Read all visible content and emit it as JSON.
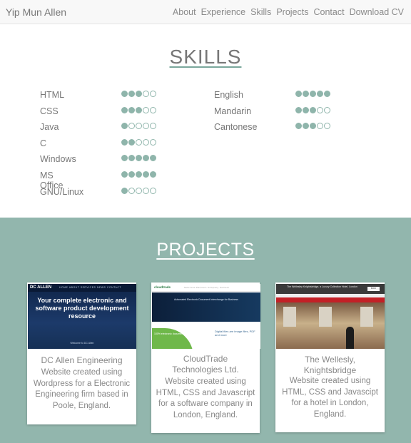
{
  "nav": {
    "brand": "Yip Mun Allen",
    "links": [
      "About",
      "Experience",
      "Skills",
      "Projects",
      "Contact",
      "Download CV"
    ]
  },
  "skills": {
    "title": "SKILLS",
    "left": [
      {
        "name": "HTML",
        "level": 3
      },
      {
        "name": "CSS",
        "level": 3
      },
      {
        "name": "Java",
        "level": 1
      },
      {
        "name": "C",
        "level": 2
      },
      {
        "name": "Windows",
        "level": 5
      },
      {
        "name": "MS Office",
        "level": 5
      },
      {
        "name": "GNU/Linux",
        "level": 1
      }
    ],
    "right": [
      {
        "name": "English",
        "level": 5
      },
      {
        "name": "Mandarin",
        "level": 3
      },
      {
        "name": "Cantonese",
        "level": 3
      }
    ],
    "max_level": 5
  },
  "projects": {
    "title": "PROJECTS",
    "cards": [
      {
        "title": "DC Allen Engineering",
        "description": "Website created using Wordpress for a Electronic Engineering firm based in Poole, England.",
        "thumb": {
          "logo": "DC ALLEN",
          "menu": "HOME  ABOUT  SERVICES  NEWS  CONTACT",
          "headline": "Your complete electronic and software product development resource",
          "sub": "Welcome to DC Allen"
        }
      },
      {
        "title": "CloudTrade Technologies Ltd.",
        "description": "Website created using HTML, CSS and Javascript for a software company in London, England.",
        "thumb": {
          "logo": "cloudtrade",
          "menu": "Solutions  Partners  Company  Contact",
          "hero": "Automated Electronic Document Interchange for Business",
          "green": "100% electronic documents in days",
          "right": "Digital files are image files, PDF and more"
        }
      },
      {
        "title": "The Wellesly, Knightsbridge",
        "description": "Website created using HTML, CSS and Javascipt for a hotel in London, England.",
        "thumb": {
          "header": "The Wellesley Knightsbridge, a Luxury Collection Hotel, London",
          "button": "BOOK"
        }
      }
    ]
  },
  "colors": {
    "accent": "#92b6ad",
    "dot": "#8fb5ab",
    "text": "#777777"
  }
}
